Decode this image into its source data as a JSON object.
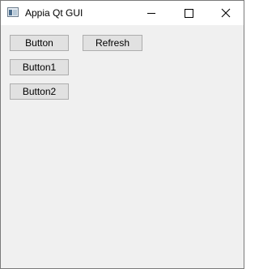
{
  "window": {
    "title": "Appia Qt GUI"
  },
  "titlebar": {
    "icons": {
      "app": "app-window-icon",
      "minimize": "minimize-icon",
      "maximize": "maximize-icon",
      "close": "close-icon"
    },
    "close_glyph": "✕"
  },
  "buttons": {
    "button": "Button",
    "refresh": "Refresh",
    "button1": "Button1",
    "button2": "Button2"
  },
  "colors": {
    "titlebar_bg": "#ffffff",
    "client_bg": "#f0f0f0",
    "button_bg": "#e1e1e1",
    "button_border": "#adadad",
    "window_border": "#7a7a7a"
  }
}
